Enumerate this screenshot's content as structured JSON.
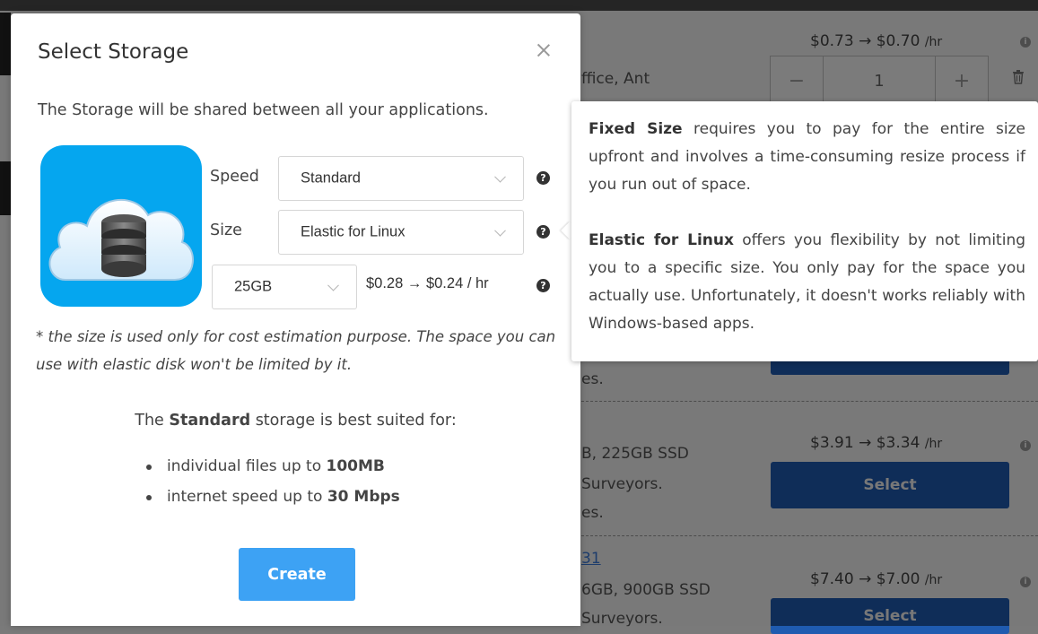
{
  "background": {
    "rows": [
      {
        "price_old": "$0.73",
        "price_new": "$0.70",
        "unit": "/hr",
        "spec_text": "ffice, Ant",
        "quantity": "1"
      },
      {
        "tail_text": "es."
      },
      {
        "price_old": "$3.91",
        "price_new": "$3.34",
        "unit": "/hr",
        "spec_text": "B, 225GB SSD",
        "desc_text": "Surveyors.",
        "tail_text": "es.",
        "button_label": "Select"
      },
      {
        "link_text": "31",
        "price_old": "$7.40",
        "price_new": "$7.00",
        "unit": "/hr",
        "spec_text": "6GB, 900GB SSD",
        "desc_text": "Surveyors.",
        "button_label": "Select"
      }
    ]
  },
  "modal": {
    "title": "Select Storage",
    "subtitle": "The Storage will be shared between all your applications.",
    "speed": {
      "label": "Speed",
      "value": "Standard"
    },
    "size": {
      "label": "Size",
      "value": "Elastic for Linux"
    },
    "capacity": {
      "value": "25GB",
      "price": "$0.28 → $0.24 / hr"
    },
    "note": "* the size is used only for cost estimation purpose. The space you can use with elastic disk won't be limited by it.",
    "suited": {
      "prefix": "The ",
      "type": "Standard",
      "suffix": " storage is best suited for:"
    },
    "bullets": [
      {
        "text": "individual files up to ",
        "strong": "100MB"
      },
      {
        "text": "internet speed up to ",
        "strong": "30 Mbps"
      }
    ],
    "create_label": "Create"
  },
  "tooltip": {
    "fixed_title": "Fixed Size",
    "fixed_text": " requires you to pay for the entire size upfront and involves a time-consuming resize process if you run out of space.",
    "elastic_title": "Elastic for Linux",
    "elastic_text": " offers you flexibility by not limiting you to a specific size. You only pay for the space you actually use. Unfortunately, it doesn't works reliably with Windows-based apps."
  },
  "colors": {
    "accent": "#3da2f4",
    "app_icon_bg": "#05a6ef",
    "bg_button": "#2f6fd0"
  },
  "icons": [
    "close-icon",
    "help-icon",
    "chevron-down-icon",
    "storage-cloud-icon",
    "info-icon",
    "trash-icon",
    "minus-icon",
    "plus-icon"
  ]
}
